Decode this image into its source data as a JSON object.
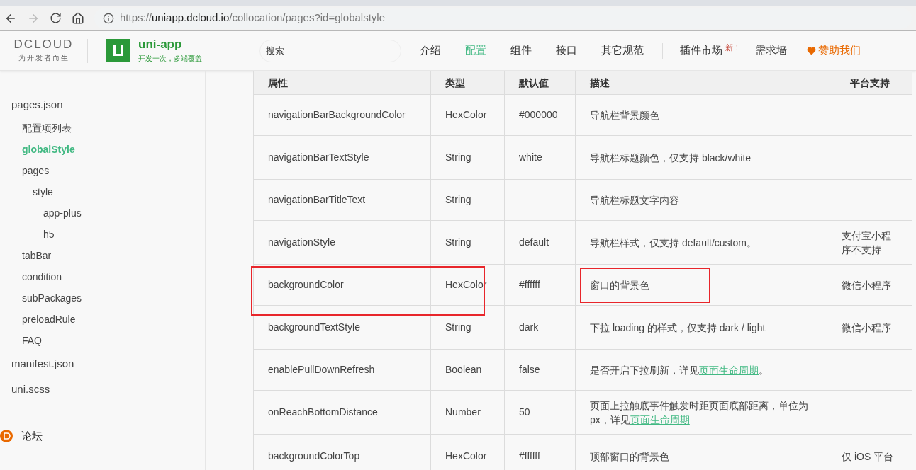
{
  "browser": {
    "back_disabled": false,
    "forward_disabled": true,
    "url": {
      "scheme": "https://",
      "host": "uniapp.dcloud.io",
      "path": "/collocation/pages?id=globalstyle"
    }
  },
  "header": {
    "brand": {
      "name": "DCLOUD",
      "slogan": "为开发者而生"
    },
    "product": {
      "name": "uni-app",
      "slogan": "开发一次，多端覆盖"
    },
    "search": {
      "placeholder": "搜索"
    },
    "nav": [
      {
        "label": "介绍",
        "selected": false,
        "divider_before": false
      },
      {
        "label": "配置",
        "selected": true,
        "divider_before": false
      },
      {
        "label": "组件",
        "selected": false,
        "divider_before": false
      },
      {
        "label": "接口",
        "selected": false,
        "divider_before": false
      },
      {
        "label": "其它规范",
        "selected": false,
        "divider_before": false
      },
      {
        "label": "插件市场",
        "selected": false,
        "divider_before": true,
        "badge": "新！"
      },
      {
        "label": "需求墙",
        "selected": false,
        "divider_before": false
      }
    ],
    "sponsor": "赞助我们"
  },
  "sidebar": {
    "items": [
      {
        "label": "pages.json",
        "selected": false,
        "children": [
          {
            "label": "配置项列表",
            "selected": false
          },
          {
            "label": "globalStyle",
            "selected": true
          },
          {
            "label": "pages",
            "selected": false,
            "children": [
              {
                "label": "style",
                "selected": false,
                "children": [
                  {
                    "label": "app-plus",
                    "selected": false
                  },
                  {
                    "label": "h5",
                    "selected": false
                  }
                ]
              }
            ]
          },
          {
            "label": "tabBar",
            "selected": false
          },
          {
            "label": "condition",
            "selected": false
          },
          {
            "label": "subPackages",
            "selected": false
          },
          {
            "label": "preloadRule",
            "selected": false
          },
          {
            "label": "FAQ",
            "selected": false
          }
        ]
      },
      {
        "label": "manifest.json",
        "selected": false
      },
      {
        "label": "uni.scss",
        "selected": false
      }
    ],
    "forum": "论坛"
  },
  "table": {
    "columns": [
      "属性",
      "类型",
      "默认值",
      "描述",
      "平台支持"
    ],
    "rows": [
      {
        "name": "navigationBarBackgroundColor",
        "type": "HexColor",
        "default": "#000000",
        "description": [
          {
            "kind": "text",
            "text": "导航栏背景颜色"
          }
        ],
        "platform": "",
        "highlighted": false
      },
      {
        "name": "navigationBarTextStyle",
        "type": "String",
        "default": "white",
        "description": [
          {
            "kind": "text",
            "text": "导航栏标题颜色，仅支持 black/white"
          }
        ],
        "platform": "",
        "highlighted": false
      },
      {
        "name": "navigationBarTitleText",
        "type": "String",
        "default": "",
        "description": [
          {
            "kind": "text",
            "text": "导航栏标题文字内容"
          }
        ],
        "platform": "",
        "highlighted": false
      },
      {
        "name": "navigationStyle",
        "type": "String",
        "default": "default",
        "description": [
          {
            "kind": "text",
            "text": "导航栏样式，仅支持 default/custom。"
          }
        ],
        "platform": "支付宝小程序不支持",
        "highlighted": false
      },
      {
        "name": "backgroundColor",
        "type": "HexColor",
        "default": "#ffffff",
        "description": [
          {
            "kind": "text",
            "text": "窗口的背景色"
          }
        ],
        "platform": "微信小程序",
        "highlighted": true
      },
      {
        "name": "backgroundTextStyle",
        "type": "String",
        "default": "dark",
        "description": [
          {
            "kind": "text",
            "text": "下拉 loading 的样式，仅支持 dark / light"
          }
        ],
        "platform": "微信小程序",
        "highlighted": false
      },
      {
        "name": "enablePullDownRefresh",
        "type": "Boolean",
        "default": "false",
        "description": [
          {
            "kind": "text",
            "text": "是否开启下拉刷新，详见"
          },
          {
            "kind": "link",
            "text": "页面生命周期"
          },
          {
            "kind": "text",
            "text": "。"
          }
        ],
        "platform": "",
        "highlighted": false
      },
      {
        "name": "onReachBottomDistance",
        "type": "Number",
        "default": "50",
        "description": [
          {
            "kind": "text",
            "text": "页面上拉触底事件触发时距页面底部距离，单位为px，详见"
          },
          {
            "kind": "link",
            "text": "页面生命周期"
          }
        ],
        "platform": "",
        "highlighted": false
      },
      {
        "name": "backgroundColorTop",
        "type": "HexColor",
        "default": "#ffffff",
        "description": [
          {
            "kind": "text",
            "text": "顶部窗口的背景色"
          }
        ],
        "platform": "仅 iOS 平台",
        "highlighted": false
      }
    ]
  }
}
